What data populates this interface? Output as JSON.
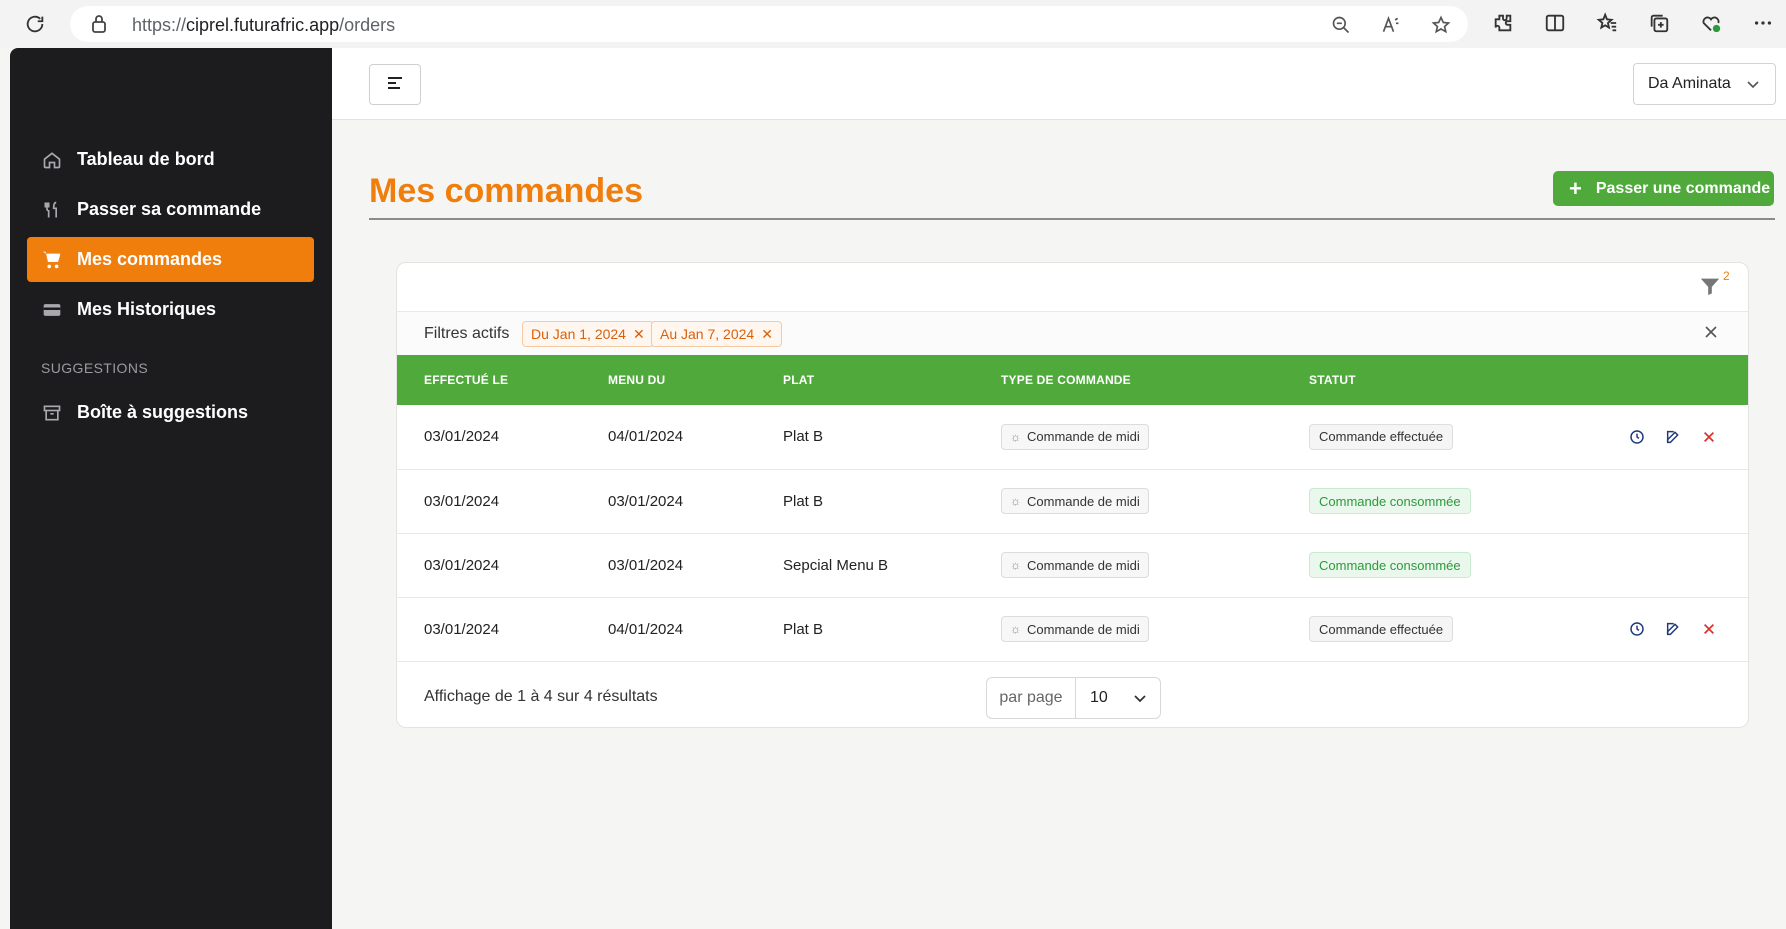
{
  "browser": {
    "url_prefix": "https://",
    "url_domain": "ciprel.futurafric.app",
    "url_path": "/orders"
  },
  "sidebar": {
    "items": [
      {
        "label": "Tableau de bord",
        "icon": "home-icon"
      },
      {
        "label": "Passer sa commande",
        "icon": "utensils-icon"
      },
      {
        "label": "Mes commandes",
        "icon": "cart-icon",
        "active": true
      },
      {
        "label": "Mes Historiques",
        "icon": "card-icon"
      }
    ],
    "section_label": "SUGGESTIONS",
    "section_items": [
      {
        "label": "Boîte à suggestions",
        "icon": "archive-icon"
      }
    ]
  },
  "header": {
    "user_name": "Da Aminata"
  },
  "page": {
    "title": "Mes commandes",
    "add_button": "Passer une commande"
  },
  "filters": {
    "count": "2",
    "label": "Filtres actifs",
    "chips": [
      "Du Jan 1, 2024",
      "Au Jan 7, 2024"
    ]
  },
  "table": {
    "headers": [
      "EFFECTUÉ LE",
      "MENU DU",
      "PLAT",
      "TYPE DE COMMANDE",
      "STATUT"
    ],
    "rows": [
      {
        "effectue": "03/01/2024",
        "menu_du": "04/01/2024",
        "plat": "Plat B",
        "type": "Commande de midi",
        "statut": "Commande effectuée"
      },
      {
        "effectue": "03/01/2024",
        "menu_du": "03/01/2024",
        "plat": "Plat B",
        "type": "Commande de midi",
        "statut": "Commande consommée"
      },
      {
        "effectue": "03/01/2024",
        "menu_du": "03/01/2024",
        "plat": "Sepcial Menu B",
        "type": "Commande de midi",
        "statut": "Commande consommée"
      },
      {
        "effectue": "03/01/2024",
        "menu_du": "04/01/2024",
        "plat": "Plat B",
        "type": "Commande de midi",
        "statut": "Commande effectuée"
      }
    ]
  },
  "footer": {
    "summary": "Affichage de 1 à 4 sur 4 résultats",
    "per_page_label": "par page",
    "per_page_value": "10"
  },
  "colors": {
    "accent": "#f07e0d",
    "green": "#4faa3b",
    "sidebar_bg": "#1c1c1e"
  }
}
